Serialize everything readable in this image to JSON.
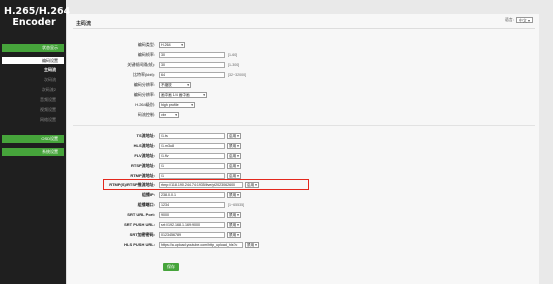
{
  "brand": {
    "line1": "H.265/H.264",
    "line2": "Encoder"
  },
  "sidebar": {
    "items": [
      {
        "label": "状态显示"
      },
      {
        "label": "编码设置"
      },
      {
        "label": "主码流"
      },
      {
        "label": "次码流"
      },
      {
        "label": "次码流2"
      },
      {
        "label": "音频设置"
      },
      {
        "label": "视频设置"
      },
      {
        "label": "网络设置"
      },
      {
        "label": "OSD设置"
      },
      {
        "label": "系统设置"
      }
    ]
  },
  "header": {
    "lang_label": "语言:",
    "lang_value": "中文"
  },
  "panel": {
    "title": "主码流"
  },
  "fields": {
    "codec": {
      "label": "编码类型:",
      "value": "H.264"
    },
    "fps": {
      "label": "编码帧率:",
      "value": "30",
      "hint": "[1-60]"
    },
    "gop": {
      "label": "关键帧间隔(帧):",
      "value": "30",
      "hint": "[1-300]"
    },
    "bitrate": {
      "label": "比特率(kbit):",
      "value": "64",
      "hint": "[32~32000]"
    },
    "resize": {
      "label": "编码分辨率:",
      "value": "不缩放"
    },
    "pip": {
      "label": "编码分辨率:",
      "value": "画中画 1/4 画中画"
    },
    "profile": {
      "label": "H.264级别:",
      "value": "high profile"
    },
    "rc": {
      "label": "码流控制:",
      "value": "vbr"
    },
    "ts": {
      "label": "TS流地址:",
      "value": "/1.ts",
      "btn": "启用"
    },
    "hls": {
      "label": "HLS流地址:",
      "value": "/1.m3u8",
      "btn": "禁用"
    },
    "flv": {
      "label": "FLV流地址:",
      "value": "/1.flv",
      "btn": "启用"
    },
    "rtsp": {
      "label": "RTSP流地址:",
      "value": "/1",
      "btn": "启用"
    },
    "rtmp": {
      "label": "RTMP流地址:",
      "value": "/1",
      "btn": "启用"
    },
    "rtmps": {
      "label": "RTMP(S)/RTSP推流地址:",
      "value": "rtmp://118.190.244.74:1935/live/yt2023062600",
      "btn": "启用"
    },
    "multicast": {
      "label": "组播IP:",
      "value": "238.0.0.1",
      "btn": "禁用"
    },
    "mport": {
      "label": "组播端口:",
      "value": "1234",
      "hint": "[1~65535]"
    },
    "srt_port": {
      "label": "SRT URL Port:",
      "value": "9000",
      "btn": "禁用"
    },
    "srt_push": {
      "label": "SRT PUSH URL:",
      "value": "srt://192.168.1.169:9000",
      "btn": "禁用"
    },
    "srt_key": {
      "label": "SRT加密密码:",
      "value": "0123456789",
      "btn": "禁用"
    },
    "hls_push": {
      "label": "HLS PUSH URL:",
      "value": "https://a.upload.youtube.com/http_upload_hls?c",
      "btn": "禁用"
    }
  },
  "save_label": "保存"
}
